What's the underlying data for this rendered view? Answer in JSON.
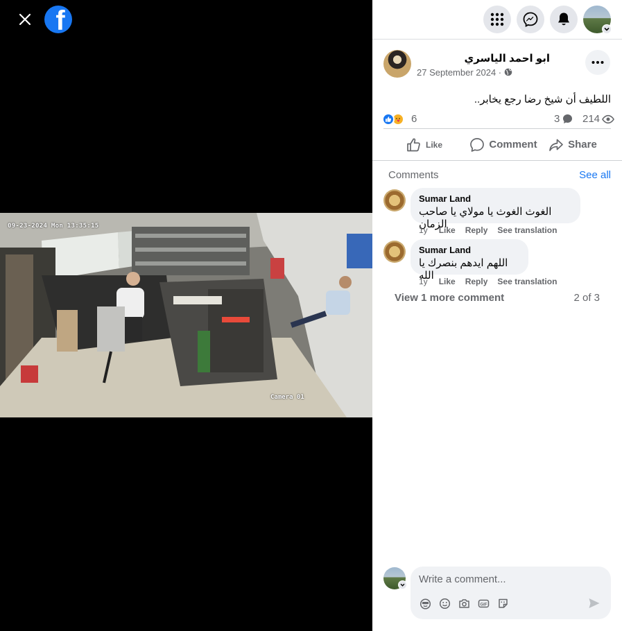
{
  "post": {
    "author": "ابو احمد الياسري",
    "date": "27 September 2024 ·",
    "text": "اللطيف أن شيخ رضا رجع يخابر..",
    "reaction_count": "6",
    "comment_count": "3",
    "view_count": "214"
  },
  "video": {
    "timestamp": "09-23-2024 Mon 13:35:15",
    "camera_label": "Camera 01"
  },
  "actions": {
    "like": "Like",
    "comment": "Comment",
    "share": "Share"
  },
  "comments_section": {
    "label": "Comments",
    "see_all": "See all",
    "view_more": "View 1 more comment",
    "page_of": "2 of 3",
    "items": [
      {
        "name": "Sumar Land",
        "text": "الغوث الغوث يا مولاي يا صاحب الزمان",
        "time": "1y",
        "like": "Like",
        "reply": "Reply",
        "translate": "See translation"
      },
      {
        "name": "Sumar Land",
        "text": "اللهم ايدهم بنصرك يا الله",
        "time": "1y",
        "like": "Like",
        "reply": "Reply",
        "translate": "See translation"
      }
    ]
  },
  "composer": {
    "placeholder": "Write a comment..."
  },
  "colors": {
    "brand": "#1877f2",
    "text_secondary": "#65676b",
    "bubble_bg": "#f0f2f5"
  }
}
